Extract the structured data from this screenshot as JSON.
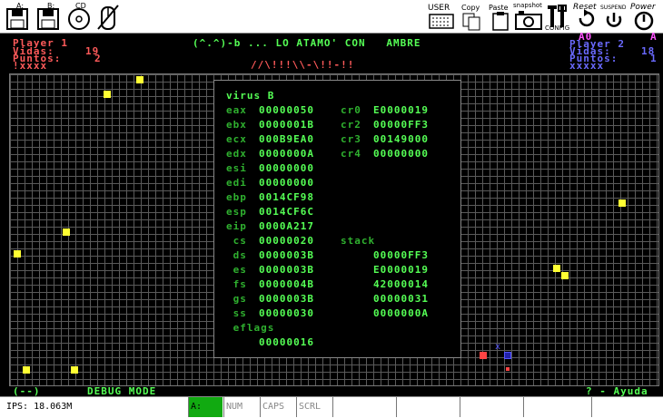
{
  "toolbar": {
    "drive_a_label": "A:",
    "drive_b_label": "B:",
    "cd_label": "CD",
    "user_label": "USER",
    "copy_label": "Copy",
    "paste_label": "Paste",
    "snapshot_label": "snapshot",
    "config_label": "CONFIG",
    "reset_label": "Reset",
    "suspend_label": "SUSPEND",
    "power_label": "Power"
  },
  "header": {
    "title": "(^.^)-b ... LO ATAMO' CON   AMBRE",
    "subtitle": "//\\!!!\\\\-\\!!-!!",
    "player1": {
      "name": "Player 1",
      "lives_label": "Vidas:",
      "lives": "19",
      "points_label": "Puntos:",
      "points": "2",
      "bar": "!xxxx"
    },
    "player2": {
      "name": "Player 2",
      "lives_label": "Vidas:",
      "lives": "18",
      "points_label": "Puntos:",
      "points": "1",
      "bar": "xxxxx",
      "tag": "A0",
      "tag2": "A"
    }
  },
  "debug": {
    "title": "virus B",
    "registers": [
      {
        "name": "eax",
        "value": "00000050"
      },
      {
        "name": "ebx",
        "value": "0000001B"
      },
      {
        "name": "ecx",
        "value": "000B9EA0"
      },
      {
        "name": "edx",
        "value": "0000000A"
      },
      {
        "name": "esi",
        "value": "00000000"
      },
      {
        "name": "edi",
        "value": "00000000"
      },
      {
        "name": "ebp",
        "value": "0014CF98"
      },
      {
        "name": "esp",
        "value": "0014CF6C"
      },
      {
        "name": "eip",
        "value": "0000A217"
      }
    ],
    "control_registers": [
      {
        "name": "cr0",
        "value": "E0000019"
      },
      {
        "name": "cr2",
        "value": "00000FF3"
      },
      {
        "name": "cr3",
        "value": "00149000"
      },
      {
        "name": "cr4",
        "value": "00000000"
      }
    ],
    "segments": [
      {
        "name": " cs",
        "value": "00000020"
      },
      {
        "name": " ds",
        "value": "0000003B"
      },
      {
        "name": " es",
        "value": "0000003B"
      },
      {
        "name": " fs",
        "value": "0000004B"
      },
      {
        "name": " gs",
        "value": "0000003B"
      },
      {
        "name": " ss",
        "value": "00000030"
      }
    ],
    "stack_label": "stack",
    "stack": [
      "00000FF3",
      "E0000019",
      "42000014",
      "00000031",
      "0000000A"
    ],
    "eflags_label": " eflags",
    "eflags": "00000016"
  },
  "footer": {
    "left": "(--)",
    "mode": "DEBUG MODE",
    "help": "? - Ayuda"
  },
  "statusbar": {
    "ips": "IPS: 18.063M",
    "drive": "A:",
    "num": "NUM",
    "caps": "CAPS",
    "scrl": "SCRL"
  },
  "colors": {
    "player1": "#ff5a5a",
    "player2": "#6a6aff",
    "text_green": "#55ff55",
    "virus_yellow": "#ffff33"
  }
}
